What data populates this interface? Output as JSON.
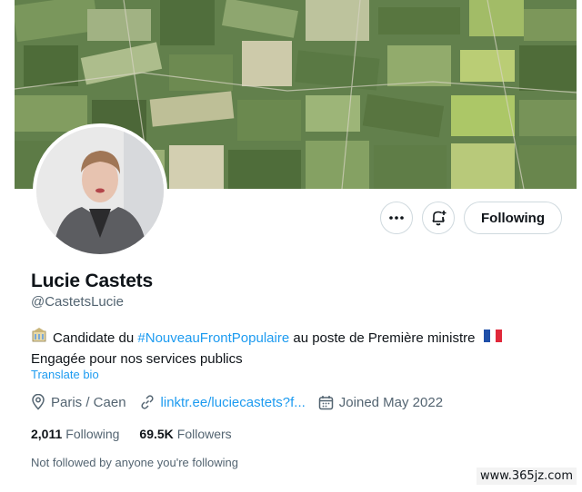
{
  "profile": {
    "name": "Lucie Castets",
    "handle": "@CastetsLucie",
    "bio": {
      "prefix": "Candidate du ",
      "hashtag": "#NouveauFrontPopulaire",
      "suffix": " au poste de Première ministre",
      "line2": "Engagée pour nos services publics",
      "leading_icon": "government-building-icon",
      "trailing_icon": "french-flag-icon"
    },
    "translate_label": "Translate bio",
    "location": "Paris / Caen",
    "website": "linktr.ee/luciecastets?f...",
    "joined": "Joined May 2022",
    "following_count": "2,011",
    "following_label": "Following",
    "followers_count": "69.5K",
    "followers_label": "Followers",
    "not_followed_note": "Not followed by anyone you're following"
  },
  "actions": {
    "more_icon": "more-icon",
    "notify_icon": "bell-plus-icon",
    "follow_label": "Following"
  },
  "watermark": "www.365jz.com",
  "colors": {
    "link": "#1d9bf0",
    "secondary_text": "#536471",
    "border": "#cfd9de"
  }
}
